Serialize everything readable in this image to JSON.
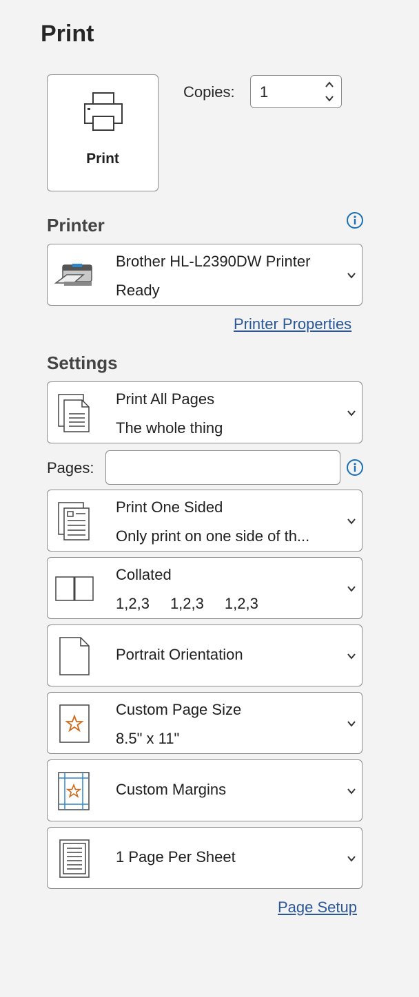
{
  "title": "Print",
  "print_button": {
    "label": "Print",
    "icon": "printer-icon"
  },
  "copies": {
    "label": "Copies:",
    "value": "1"
  },
  "printer": {
    "section_title": "Printer",
    "name": "Brother HL-L2390DW Printer",
    "status": "Ready",
    "properties_link": "Printer Properties"
  },
  "settings": {
    "section_title": "Settings",
    "pages_range": {
      "title": "Print All Pages",
      "subtitle": "The whole thing"
    },
    "pages_label": "Pages:",
    "pages_value": "",
    "sides": {
      "title": "Print One Sided",
      "subtitle": "Only print on one side of th..."
    },
    "collation": {
      "title": "Collated",
      "nums": [
        "1,2,3",
        "1,2,3",
        "1,2,3"
      ]
    },
    "orientation": {
      "title": "Portrait Orientation"
    },
    "page_size": {
      "title": "Custom Page Size",
      "subtitle": "8.5\" x 11\""
    },
    "margins": {
      "title": "Custom Margins"
    },
    "per_sheet": {
      "title": "1 Page Per Sheet"
    },
    "page_setup_link": "Page Setup"
  },
  "colors": {
    "accent_link": "#2b5797",
    "info_blue": "#1a6fb5",
    "star_orange": "#d06a1b",
    "margin_blue": "#2e86c8"
  }
}
